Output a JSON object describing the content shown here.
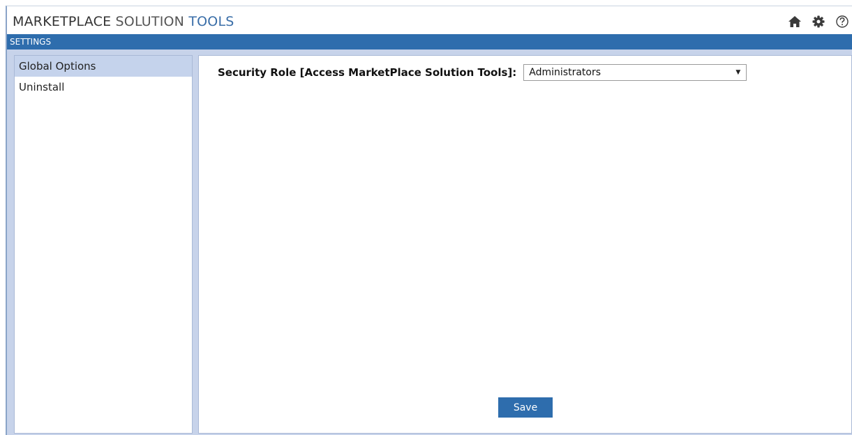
{
  "app": {
    "title_part1": "MARKETPLACE",
    "title_part2": "SOLUTION",
    "title_part3": "TOOLS"
  },
  "header_icons": [
    "home-icon",
    "gear-icon",
    "help-icon"
  ],
  "section_title": "SETTINGS",
  "sidebar": {
    "items": [
      {
        "label": "Global Options",
        "active": true
      },
      {
        "label": "Uninstall",
        "active": false
      }
    ]
  },
  "form": {
    "security_role_label": "Security Role [Access MarketPlace Solution Tools]:",
    "security_role_value": "Administrators"
  },
  "buttons": {
    "save_label": "Save"
  },
  "colors": {
    "accent": "#2e6dad",
    "title_blue": "#3a6ea8",
    "panel_bg": "#c7d3ea",
    "active_item": "#c5d3ec"
  }
}
